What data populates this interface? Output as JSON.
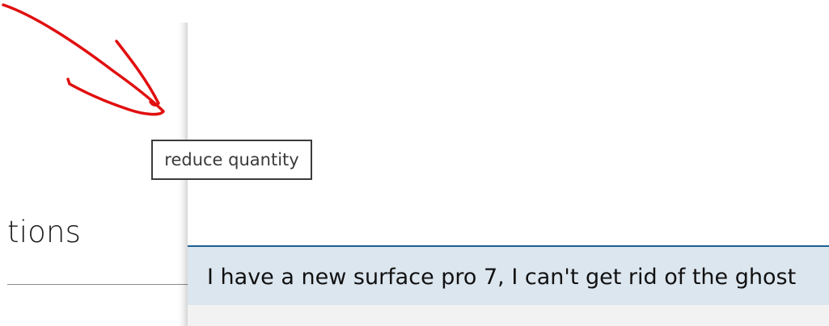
{
  "background_page": {
    "heading_fragment": "tions"
  },
  "tooltip": {
    "text": "reduce quantity"
  },
  "search_panel": {
    "result_text": "I have a new surface pro 7, I can't get rid of the ghost"
  },
  "annotation": {
    "type": "red-hand-drawn-arrow",
    "color": "#e10f0f"
  },
  "colors": {
    "selected_row_bg": "#dce6ef",
    "selected_row_accent": "#1b5e8f",
    "tooltip_border": "#3b3b3b"
  }
}
